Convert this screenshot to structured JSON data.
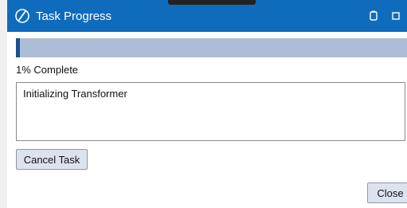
{
  "window": {
    "title": "Task Progress",
    "app_icon": "brand-swirl-icon",
    "controls": [
      "minimize-icon",
      "maximize-icon"
    ]
  },
  "progress": {
    "fraction": 0.01,
    "label": "1% Complete"
  },
  "log": {
    "text": "Initializing Transformer"
  },
  "buttons": {
    "cancel_label": "Cancel Task",
    "close_label": "Close"
  },
  "colors": {
    "titlebar": "#0f6cbd",
    "progress_track": "#aebdd6",
    "progress_fill": "#1c4f8c",
    "button_bg": "#dde3ee"
  }
}
